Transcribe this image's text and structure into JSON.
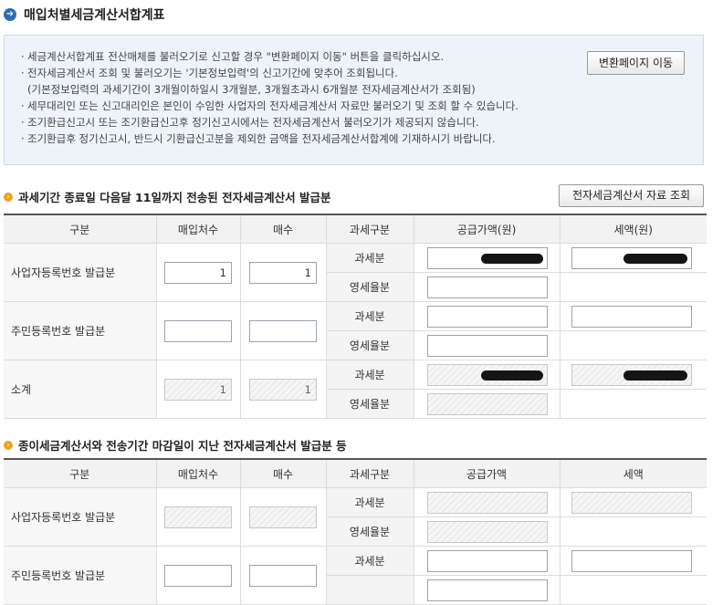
{
  "header": {
    "title": "매입처별세금계산서합계표",
    "icon": "arrow-right-circle-icon"
  },
  "notice": {
    "lines": [
      "세금계산서합계표 전산매체를 불러오기로 신고할 경우 \"변환페이지 이동\" 버튼을 클릭하십시오.",
      "전자세금계산서 조회 및 불러오기는 '기본정보입력'의 신고기간에 맞추어 조회됩니다.",
      "(기본정보입력의 과세기간이 3개월이하일시 3개월분, 3개월초과시 6개월분 전자세금계산서가 조회됨)",
      "세무대리인 또는 신고대리인은 본인이 수임한 사업자의 전자세금계산서 자료만 불러오기 및 조회 할 수 있습니다.",
      "조기환급신고시 또는 조기환급신고후 정기신고시에서는 전자세금계산서 불러오기가 제공되지 않습니다.",
      "조기환급후 정기신고시, 반드시 기환급신고분을 제외한 금액을 전자세금계산서합계에 기재하시기 바랍니다."
    ],
    "convert_button": "변환페이지 이동"
  },
  "section1": {
    "title": "과세기간 종료일 다음달 11일까지 전송된 전자세금계산서 발급분",
    "query_button": "전자세금계산서 자료 조회",
    "headers": [
      "구분",
      "매입처수",
      "매수",
      "과세구분",
      "공급가액(원)",
      "세액(원)"
    ],
    "rows": [
      {
        "label": "사업자등록번호 발급분",
        "count": "1",
        "sheets": "1",
        "type1": "과세분",
        "type2": "영세율분"
      },
      {
        "label": "주민등록번호 발급분",
        "count": "",
        "sheets": "",
        "type1": "과세분",
        "type2": "영세율분"
      },
      {
        "label": "소계",
        "count": "1",
        "sheets": "1",
        "type1": "과세분",
        "type2": "영세율분"
      }
    ]
  },
  "section2": {
    "title": "종이세금계산서와 전송기간 마감일이 지난 전자세금계산서 발급분 등",
    "headers": [
      "구분",
      "매입처수",
      "매수",
      "과세구분",
      "공급가액",
      "세액"
    ],
    "rows": [
      {
        "label": "사업자등록번호 발급분",
        "type1": "과세분",
        "type2": "영세율분"
      },
      {
        "label": "주민등록번호 발급분",
        "type1": "과세분"
      }
    ]
  },
  "colors": {
    "accent": "#2d6cb5",
    "section_bullet": "#f0a01a",
    "notice_bg": "#eef3f9"
  }
}
